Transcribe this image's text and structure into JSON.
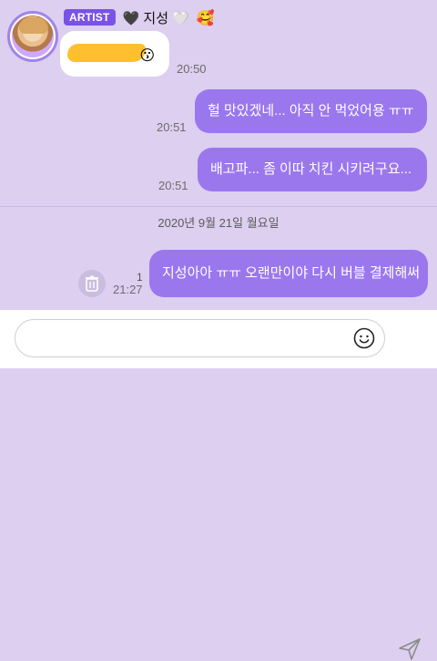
{
  "header": {
    "badge": "ARTIST",
    "name_prefix": "🖤",
    "name": "지성",
    "name_suffix": "🤍",
    "emoji": "🥰"
  },
  "messages": [
    {
      "type": "incoming",
      "content": "redacted",
      "emoji": "😗",
      "time": "20:50"
    },
    {
      "type": "outgoing",
      "text": "헐 맛있겠네... 아직 안 먹었어용 ㅠㅠ",
      "time": "20:51"
    },
    {
      "type": "outgoing",
      "text": "배고파... 좀 이따 치킨 시키려구요...",
      "time": "20:51"
    },
    {
      "type": "date",
      "text": "2020년 9월 21일 월요일"
    },
    {
      "type": "outgoing",
      "text": "지성아아 ㅠㅠ 오랜만이야 다시 버블 결제해써",
      "time": "21:27",
      "unread": "1"
    }
  ],
  "composer": {
    "placeholder": ""
  },
  "colors": {
    "background": "#dccff0",
    "bubble_out": "#9b77ee",
    "badge": "#7a52e6"
  }
}
